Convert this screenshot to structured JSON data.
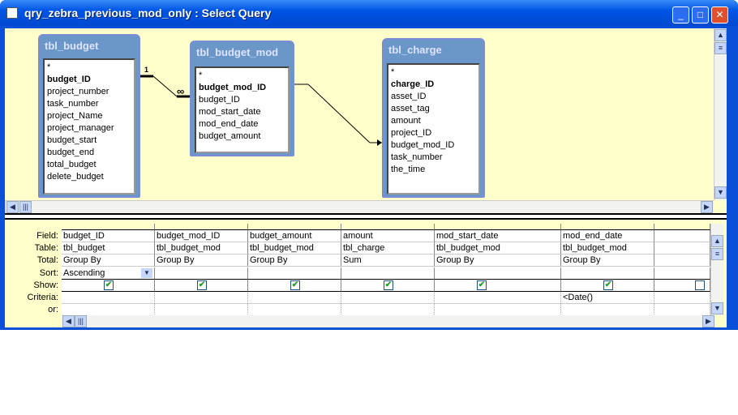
{
  "window": {
    "title": "qry_zebra_previous_mod_only : Select Query",
    "minimize": "_",
    "maximize": "□",
    "close": "✕"
  },
  "tables": [
    {
      "name": "tbl_budget",
      "fields": [
        "*",
        "budget_ID",
        "project_number",
        "task_number",
        "project_Name",
        "project_manager",
        "budget_start",
        "budget_end",
        "total_budget",
        "delete_budget"
      ],
      "key": "budget_ID"
    },
    {
      "name": "tbl_budget_mod",
      "fields": [
        "*",
        "budget_mod_ID",
        "budget_ID",
        "mod_start_date",
        "mod_end_date",
        "budget_amount"
      ],
      "key": "budget_mod_ID"
    },
    {
      "name": "tbl_charge",
      "fields": [
        "*",
        "charge_ID",
        "asset_ID",
        "asset_tag",
        "amount",
        "project_ID",
        "budget_mod_ID",
        "task_number",
        "the_time"
      ],
      "key": "charge_ID"
    }
  ],
  "join": {
    "one": "1",
    "many": "∞"
  },
  "grid": {
    "row_labels": [
      "Field:",
      "Table:",
      "Total:",
      "Sort:",
      "Show:",
      "Criteria:",
      "or:"
    ],
    "columns": [
      {
        "field": "budget_ID",
        "table": "tbl_budget",
        "total": "Group By",
        "sort": "Ascending",
        "show": true,
        "criteria": ""
      },
      {
        "field": "budget_mod_ID",
        "table": "tbl_budget_mod",
        "total": "Group By",
        "sort": "",
        "show": true,
        "criteria": ""
      },
      {
        "field": "budget_amount",
        "table": "tbl_budget_mod",
        "total": "Group By",
        "sort": "",
        "show": true,
        "criteria": ""
      },
      {
        "field": "amount",
        "table": "tbl_charge",
        "total": "Sum",
        "sort": "",
        "show": true,
        "criteria": ""
      },
      {
        "field": "mod_start_date",
        "table": "tbl_budget_mod",
        "total": "Group By",
        "sort": "",
        "show": true,
        "criteria": ""
      },
      {
        "field": "mod_end_date",
        "table": "tbl_budget_mod",
        "total": "Group By",
        "sort": "",
        "show": true,
        "criteria": "<Date()"
      },
      {
        "field": "",
        "table": "",
        "total": "",
        "sort": "",
        "show": false,
        "criteria": ""
      }
    ]
  }
}
